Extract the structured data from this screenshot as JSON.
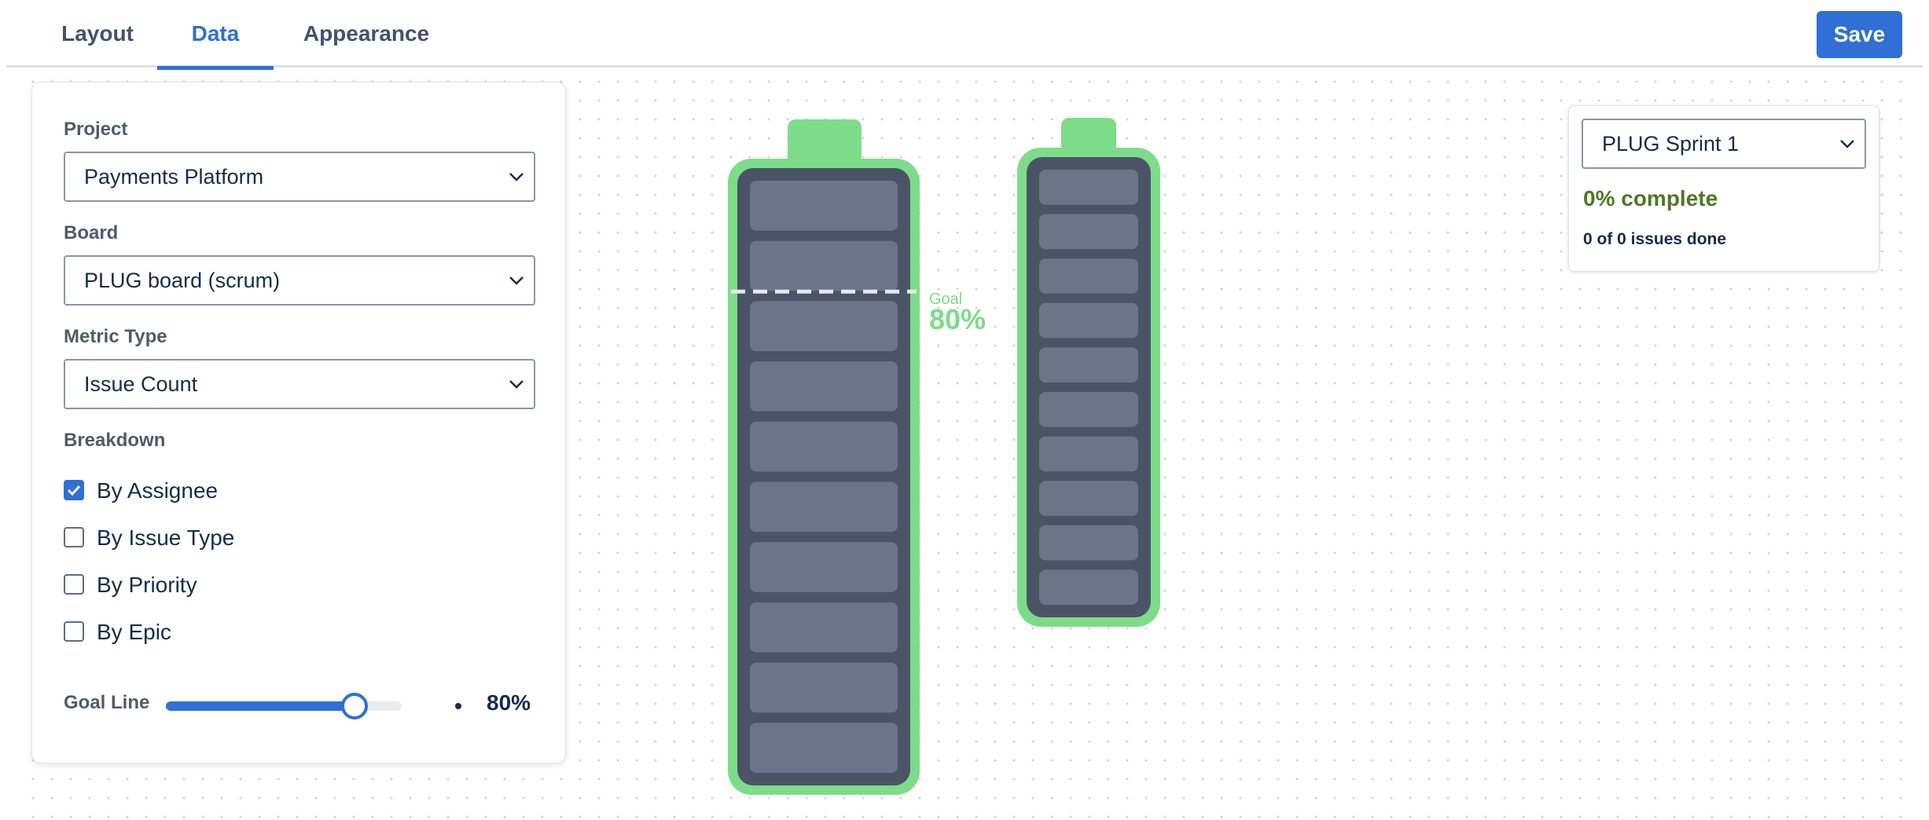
{
  "tabs": [
    {
      "label": "Layout",
      "active": false
    },
    {
      "label": "Data",
      "active": true
    },
    {
      "label": "Appearance",
      "active": false
    }
  ],
  "save_label": "Save",
  "panel": {
    "project_label": "Project",
    "project_value": "Payments Platform",
    "board_label": "Board",
    "board_value": "PLUG board (scrum)",
    "metric_label": "Metric Type",
    "metric_value": "Issue Count",
    "breakdown_label": "Breakdown",
    "breakdown_options": [
      {
        "label": "By Assignee",
        "checked": true
      },
      {
        "label": "By Issue Type",
        "checked": false
      },
      {
        "label": "By Priority",
        "checked": false
      },
      {
        "label": "By Epic",
        "checked": false
      }
    ],
    "goal_label": "Goal Line",
    "goal_value": "80%",
    "goal_fraction": 0.8
  },
  "sprint_card": {
    "sprint_value": "PLUG Sprint 1",
    "percent_complete": "0% complete",
    "issues_done": "0 of 0 issues done"
  },
  "goal_marker": {
    "label": "Goal",
    "value": "80%"
  },
  "colors": {
    "accent": "#2f6fd6",
    "battery_green": "#7ddc8a",
    "battery_body": "#4a5466",
    "battery_cell": "#6a7589",
    "complete_text": "#4c7a24"
  },
  "chart_data": {
    "type": "bar",
    "series": [
      {
        "cells": 10,
        "filled_cells": 0
      },
      {
        "cells": 10,
        "filled_cells": 0
      }
    ],
    "goal_fraction": 0.8
  }
}
